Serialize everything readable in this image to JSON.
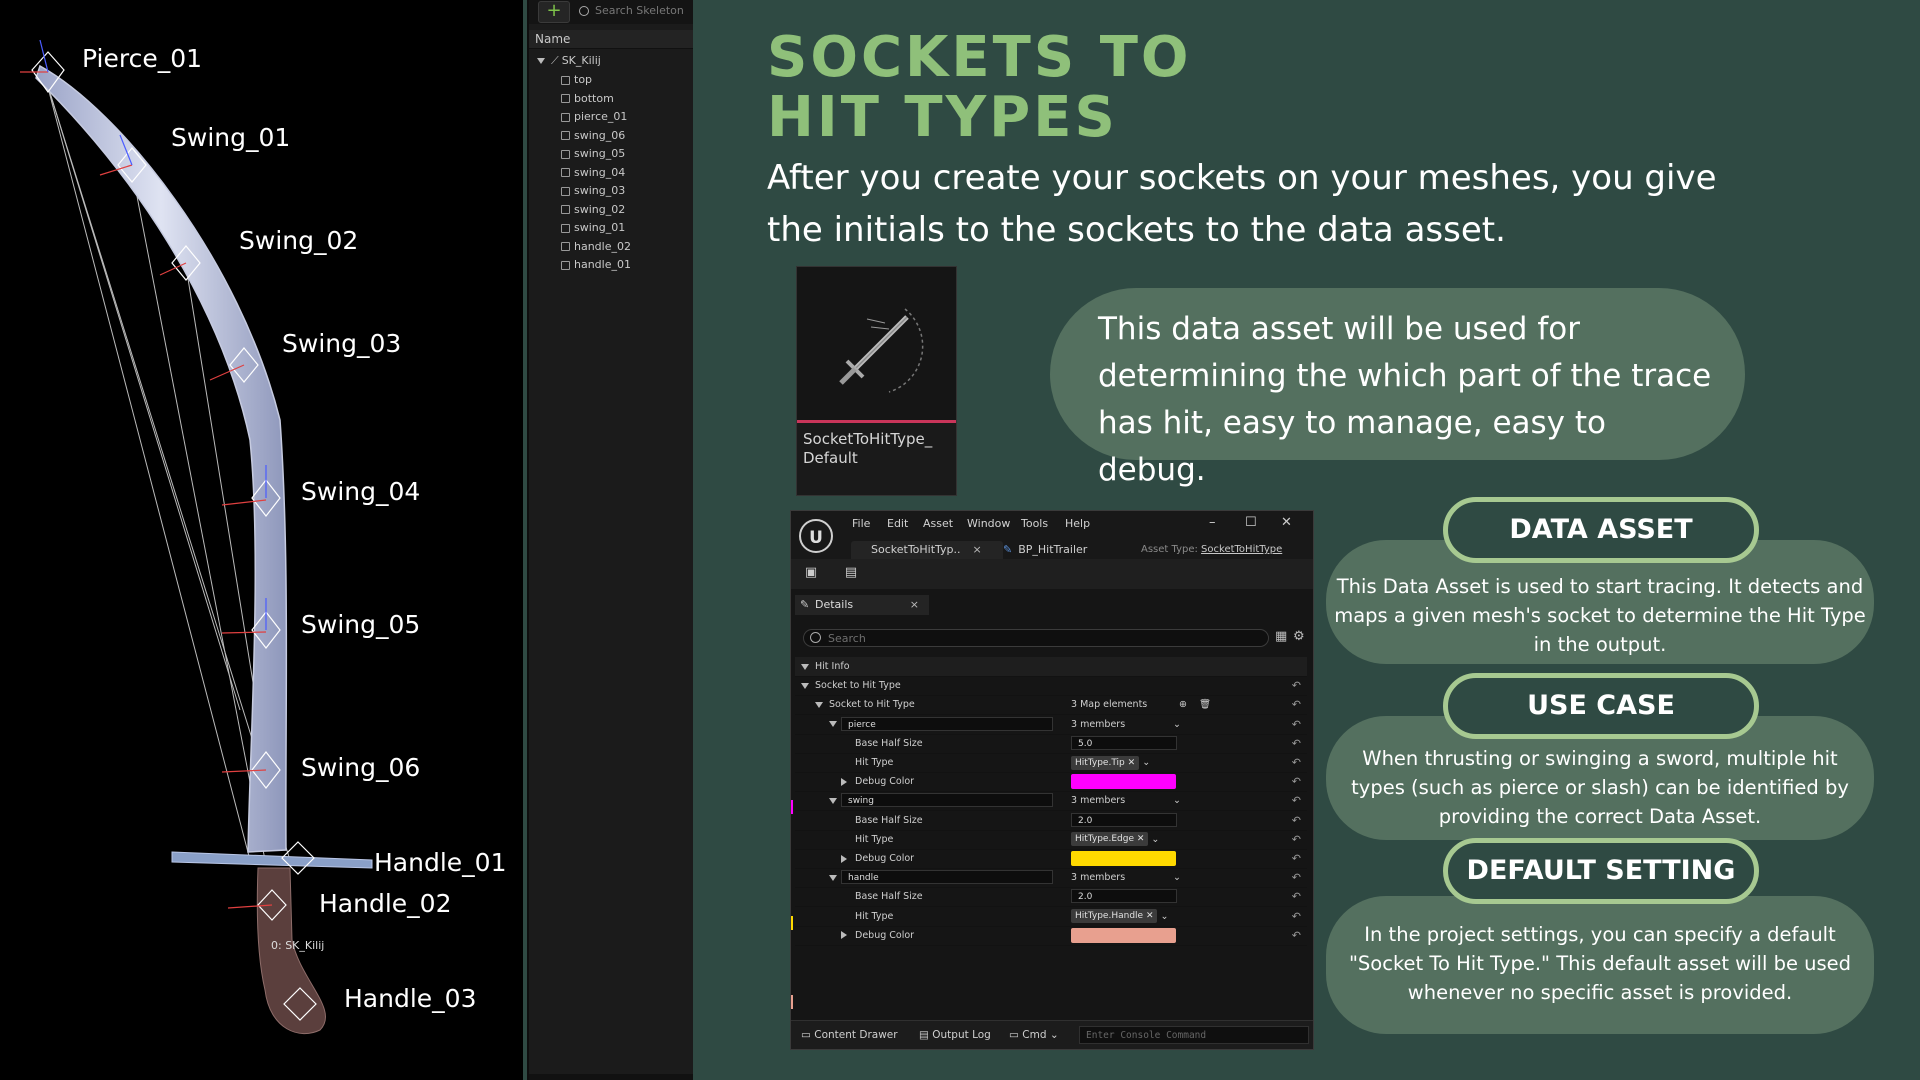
{
  "viewport": {
    "bones": {
      "pierce_01": "Pierce_01",
      "swing_01": "Swing_01",
      "swing_02": "Swing_02",
      "swing_03": "Swing_03",
      "swing_04": "Swing_04",
      "swing_05": "Swing_05",
      "swing_06": "Swing_06",
      "handle_01": "Handle_01",
      "handle_02": "Handle_02",
      "handle_03": "Handle_03"
    },
    "caption": "0: SK_Kilij"
  },
  "skeleton_tree": {
    "add_label": "+",
    "search_placeholder": "Search Skeleton",
    "column_header": "Name",
    "root": "SK_Kilij",
    "sockets": [
      "top",
      "bottom",
      "pierce_01",
      "swing_06",
      "swing_05",
      "swing_04",
      "swing_03",
      "swing_02",
      "swing_01",
      "handle_02",
      "handle_01"
    ]
  },
  "slide": {
    "title_line1": "SOCKETS TO",
    "title_line2": "HIT TYPES",
    "intro": "After you create your sockets on your meshes, you give the initials to the sockets to the data asset.",
    "asset_name": "SocketToHitType_ Default",
    "bubble": "This data asset will be used for determining the which part of the trace has hit, easy to manage, easy to debug."
  },
  "editor": {
    "logo": "U",
    "menus": [
      "File",
      "Edit",
      "Asset",
      "Window",
      "Tools",
      "Help"
    ],
    "tabs": {
      "active": "SocketToHitTyp..",
      "active_close": "×",
      "second": "BP_HitTrailer"
    },
    "asset_type_label": "Asset Type:",
    "asset_type_value": "SocketToHitType",
    "details_tab": "Details",
    "details_close": "×",
    "search_placeholder": "Search",
    "category": "Hit Info",
    "map_row": "Socket to Hit Type",
    "map_inner": "Socket to Hit Type",
    "map_count": "3 Map elements",
    "entries": [
      {
        "key": "pierce",
        "members": "3 members",
        "base_half_size_label": "Base Half Size",
        "base_half_size": "5.0",
        "hit_type_label": "Hit Type",
        "hit_type": "HitType.Tip",
        "debug_color_label": "Debug Color",
        "color": "#ff00ff"
      },
      {
        "key": "swing",
        "members": "3 members",
        "base_half_size_label": "Base Half Size",
        "base_half_size": "2.0",
        "hit_type_label": "Hit Type",
        "hit_type": "HitType.Edge",
        "debug_color_label": "Debug Color",
        "color": "#ffd900"
      },
      {
        "key": "handle",
        "members": "3 members",
        "base_half_size_label": "Base Half Size",
        "base_half_size": "2.0",
        "hit_type_label": "Hit Type",
        "hit_type": "HitType.Handle",
        "debug_color_label": "Debug Color",
        "color": "#e8a08f"
      }
    ],
    "statusbar": {
      "content_drawer": "Content Drawer",
      "output_log": "Output Log",
      "cmd": "Cmd",
      "console_placeholder": "Enter Console Command"
    }
  },
  "cards": [
    {
      "heading": "DATA ASSET",
      "body": "This Data Asset is used to start tracing. It detects and maps a given mesh's socket to determine the Hit Type in the output."
    },
    {
      "heading": "USE CASE",
      "body": "When thrusting or swinging a sword, multiple hit types (such as pierce or slash) can be identified by providing the correct Data Asset."
    },
    {
      "heading": "DEFAULT SETTING",
      "body": "In the project settings, you can specify a default \"Socket To Hit Type.\" This default asset will be used whenever no specific asset is provided."
    }
  ],
  "colors": {
    "background": "#2f4a43",
    "title": "#8fc07a",
    "card": "#54705f",
    "pill_border": "#a7c991",
    "asset_bar": "#c9355a"
  }
}
